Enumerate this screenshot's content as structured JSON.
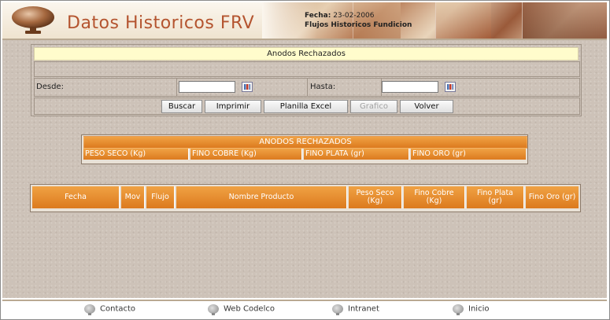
{
  "header": {
    "title": "Datos Historicos FRV",
    "fecha_label": "Fecha:",
    "fecha_value": "23-02-2006",
    "subtitle": "Flujos Historicos Fundicion"
  },
  "form": {
    "section_title": "Anodos Rechazados",
    "desde_label": "Desde:",
    "desde_value": "",
    "hasta_label": "Hasta:",
    "hasta_value": "",
    "buttons": {
      "buscar": "Buscar",
      "imprimir": "Imprimir",
      "planilla": "Planilla Excel",
      "grafico": "Grafico",
      "volver": "Volver"
    }
  },
  "summary": {
    "title": "ANODOS RECHAZADOS",
    "columns": [
      "PESO SECO (Kg)",
      "FINO COBRE (Kg)",
      "FINO PLATA (gr)",
      "FINO ORO (gr)"
    ]
  },
  "detail": {
    "columns": [
      {
        "l1": "Fecha",
        "l2": ""
      },
      {
        "l1": "Mov",
        "l2": ""
      },
      {
        "l1": "Flujo",
        "l2": ""
      },
      {
        "l1": "Nombre Producto",
        "l2": ""
      },
      {
        "l1": "Peso Seco",
        "l2": "(Kg)"
      },
      {
        "l1": "Fino Cobre",
        "l2": "(Kg)"
      },
      {
        "l1": "Fino Plata",
        "l2": "(gr)"
      },
      {
        "l1": "Fino Oro (gr)",
        "l2": ""
      }
    ]
  },
  "footer": {
    "links": [
      "Contacto",
      "Web Codelco",
      "Intranet",
      "Inicio"
    ]
  },
  "colors": {
    "accent_orange": "#dc7a1e",
    "title_color": "#b4542f",
    "form_title_bg": "#fffccc"
  }
}
